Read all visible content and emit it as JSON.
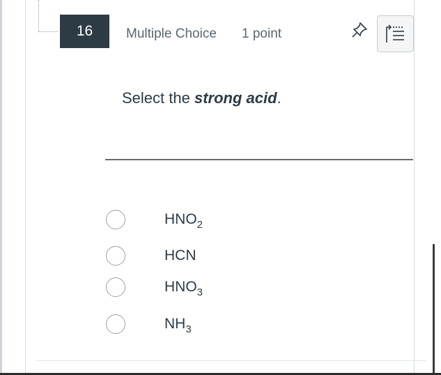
{
  "question": {
    "number": "16",
    "type": "Multiple Choice",
    "points": "1 point",
    "prompt_before": "Select the ",
    "prompt_emphasis": "strong acid",
    "prompt_after": "."
  },
  "icons": {
    "pin": "pin-icon",
    "outline": "outline-list-icon"
  },
  "answers": [
    {
      "base": "HNO",
      "subscript": "2"
    },
    {
      "base": "HCN",
      "subscript": ""
    },
    {
      "base": "HNO",
      "subscript": "3"
    },
    {
      "base": "NH",
      "subscript": "3"
    }
  ],
  "colors": {
    "badge_bg": "#2d3b45",
    "text": "#2d3b45",
    "muted": "#5b6670"
  }
}
